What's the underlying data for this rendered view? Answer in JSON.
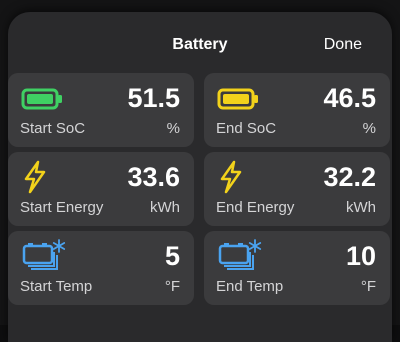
{
  "sheet": {
    "title": "Battery",
    "done_label": "Done"
  },
  "cards": [
    {
      "label": "Start SoC",
      "value": "51.5",
      "unit": "%",
      "icon": "battery-green-icon",
      "color": "#3fd163"
    },
    {
      "label": "End SoC",
      "value": "46.5",
      "unit": "%",
      "icon": "battery-yellow-icon",
      "color": "#f2d21b"
    },
    {
      "label": "Start Energy",
      "value": "33.6",
      "unit": "kWh",
      "icon": "lightning-bolt-icon",
      "color": "#f2d21b"
    },
    {
      "label": "End Energy",
      "value": "32.2",
      "unit": "kWh",
      "icon": "lightning-bolt-icon",
      "color": "#f2d21b"
    },
    {
      "label": "Start Temp",
      "value": "5",
      "unit": "°F",
      "icon": "battery-temperature-icon",
      "color": "#4aa3f0"
    },
    {
      "label": "End Temp",
      "value": "10",
      "unit": "°F",
      "icon": "battery-temperature-icon",
      "color": "#4aa3f0"
    }
  ]
}
